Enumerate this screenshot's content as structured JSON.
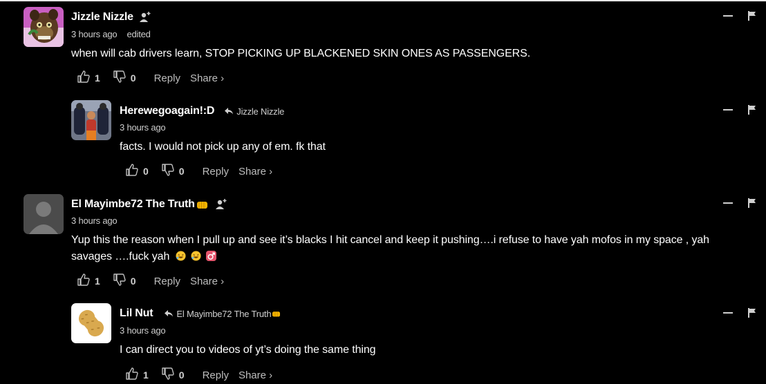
{
  "comments": [
    {
      "author": "Jizzle Nizzle",
      "time": "3 hours ago",
      "edited": "edited",
      "text": "when will cab drivers learn, STOP PICKING UP BLACKENED SKIN ONES AS PASSENGERS.",
      "likes": "1",
      "dislikes": "0",
      "reply_label": "Reply",
      "share_label": "Share ›"
    },
    {
      "author": "Herewegoagain!:D",
      "reply_to": "Jizzle Nizzle",
      "time": "3 hours ago",
      "text": "facts. I would not pick up any of em. fk that",
      "likes": "0",
      "dislikes": "0",
      "reply_label": "Reply",
      "share_label": "Share ›"
    },
    {
      "author": "El Mayimbe72 The Truth",
      "time": "3 hours ago",
      "text_line1": "Yup this the reason when I pull up and see it’s blacks I hit cancel and keep it pushing….i refuse to have yah mofos in my space , yah",
      "text_line2": "savages ….fuck yah",
      "likes": "1",
      "dislikes": "0",
      "reply_label": "Reply",
      "share_label": "Share ›"
    },
    {
      "author": "Lil Nut",
      "reply_to": "El Mayimbe72 The Truth",
      "time": "3 hours ago",
      "text": "I can direct you to videos of yt’s doing the same thing",
      "likes": "1",
      "dislikes": "0",
      "reply_label": "Reply",
      "share_label": "Share ›"
    }
  ],
  "icons": {
    "follow": "add-user-icon",
    "like": "thumbs-up-icon",
    "dislike": "thumbs-down-icon",
    "collapse": "minus-icon",
    "flag": "flag-icon",
    "reply_arrow": "reply-arrow-icon",
    "emoji_fist": "oncoming-fist-emoji",
    "emoji_laugh": "rolling-laughing-emoji",
    "emoji_male": "male-sign-emoji"
  },
  "colors": {
    "background": "#000000",
    "text": "#ffffff",
    "muted": "#cfcfcf"
  }
}
